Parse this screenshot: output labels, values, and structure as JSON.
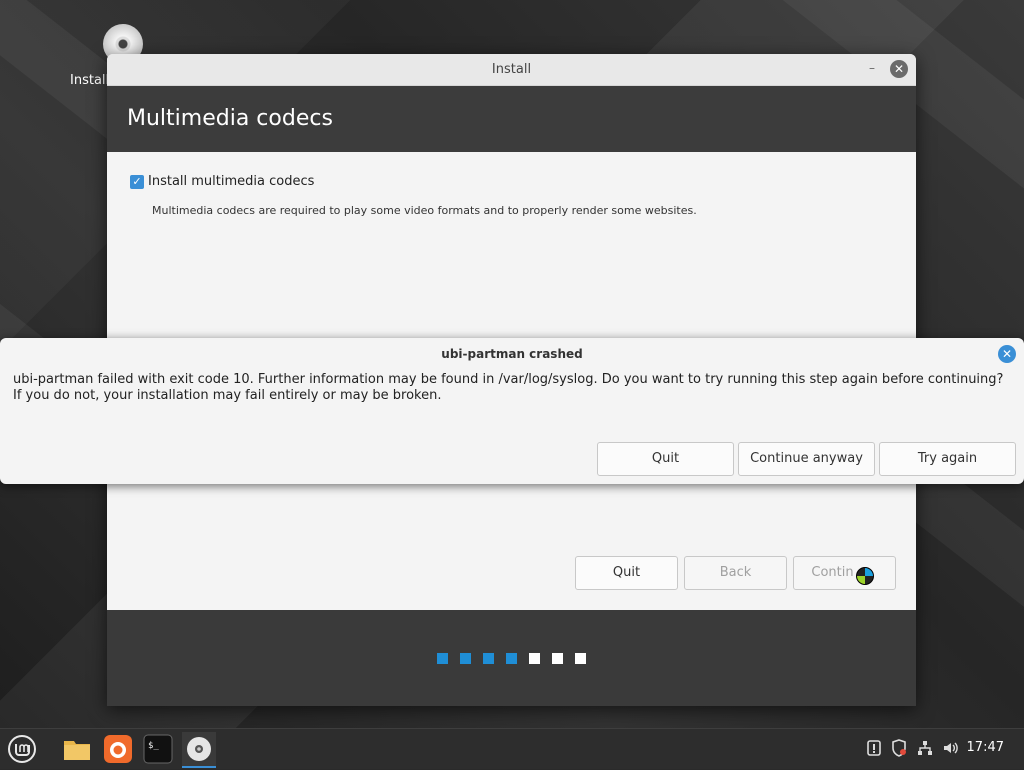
{
  "desktop": {
    "icon_label": "Install"
  },
  "installer": {
    "window_title": "Install",
    "page_title": "Multimedia codecs",
    "checkbox_label": "Install multimedia codecs",
    "checkbox_checked": true,
    "description": "Multimedia codecs are required to play some video formats and to properly render some websites.",
    "buttons": {
      "quit": "Quit",
      "back": "Back",
      "continue": "Contin"
    },
    "progress": {
      "total_steps": 7,
      "completed_steps": 4,
      "active_color": "#1f8ed6",
      "inactive_color": "#ffffff"
    }
  },
  "dialog": {
    "title": "ubi-partman crashed",
    "message": "ubi-partman failed with exit code 10. Further information may be found in /var/log/syslog. Do you want to try running this step again before continuing? If you do not, your installation may fail entirely or may be broken.",
    "buttons": {
      "quit": "Quit",
      "continue_anyway": "Continue anyway",
      "try_again": "Try again"
    }
  },
  "taskbar": {
    "apps": [
      "menu-icon",
      "files-icon",
      "firefox-icon",
      "terminal-icon",
      "installer-disc-icon"
    ],
    "tray_icons": [
      "update-notice-icon",
      "shield-icon",
      "network-icon",
      "volume-icon"
    ],
    "clock": "17:47"
  },
  "colors": {
    "accent": "#3a8fd6",
    "header_bg": "#3c3c3c"
  }
}
